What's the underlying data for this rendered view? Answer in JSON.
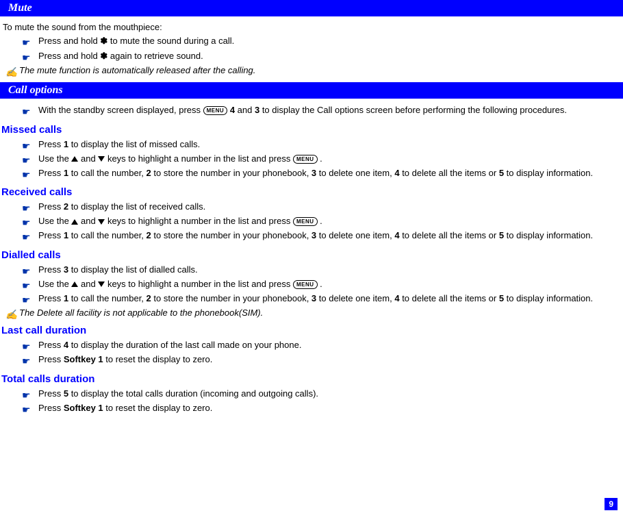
{
  "sections": {
    "mute": {
      "title": "Mute",
      "intro": "To mute the sound from the mouthpiece:",
      "bullets": [
        {
          "prefix": "Press and hold ",
          "icon": "asterisk",
          "suffix": " to mute the sound during a call."
        },
        {
          "prefix": "Press and hold ",
          "icon": "asterisk",
          "suffix": " again to retrieve sound."
        }
      ],
      "note": "The mute function is automatically released after the calling."
    },
    "callOptions": {
      "title": "Call options",
      "bullets": [
        {
          "prefix": "With the standby screen displayed, press ",
          "menu": true,
          "mid": " ",
          "b1": "4",
          "mid2": " and ",
          "b2": "3",
          "suffix": " to display the Call options screen before performing the following procedures."
        }
      ]
    },
    "missedCalls": {
      "title": "Missed calls",
      "bullets": [
        {
          "prefix": "Press ",
          "b1": "1",
          "suffix": " to display the list of missed calls."
        },
        {
          "prefix": "Use the ",
          "updown": true,
          "mid": " keys to highlight a number in the list and press ",
          "menu": true,
          "suffix": " ."
        },
        {
          "prefix": "Press ",
          "b1": "1",
          "mid": " to call the number, ",
          "b2": "2",
          "mid2": " to store the number in your phonebook, ",
          "b3": "3",
          "mid3": " to delete one item, ",
          "b4": "4",
          "mid4": " to delete all the items or ",
          "b5": "5",
          "suffix": " to display information."
        }
      ]
    },
    "receivedCalls": {
      "title": "Received calls",
      "bullets": [
        {
          "prefix": "Press ",
          "b1": "2",
          "suffix": " to display the list of received calls."
        },
        {
          "prefix": "Use the ",
          "updown": true,
          "mid": " keys to highlight a number in the list and press ",
          "menu": true,
          "suffix": " ."
        },
        {
          "prefix": "Press ",
          "b1": "1",
          "mid": " to call the number, ",
          "b2": "2",
          "mid2": " to store the number in your phonebook, ",
          "b3": "3",
          "mid3": " to delete one item, ",
          "b4": "4",
          "mid4": " to delete all the items or ",
          "b5": "5",
          "suffix": " to display information."
        }
      ]
    },
    "dialledCalls": {
      "title": "Dialled calls",
      "bullets": [
        {
          "prefix": "Press ",
          "b1": "3",
          "suffix": " to display the list of dialled calls."
        },
        {
          "prefix": "Use the ",
          "updown": true,
          "mid": " keys to highlight a number in the list and press ",
          "menu": true,
          "suffix": " ."
        },
        {
          "prefix": "Press ",
          "b1": "1",
          "mid": " to call the number, ",
          "b2": "2",
          "mid2": " to store the number in your phonebook, ",
          "b3": "3",
          "mid3": " to delete one item, ",
          "b4": "4",
          "mid4": " to delete all the items or ",
          "b5": "5",
          "suffix": " to display information."
        }
      ],
      "note": "The Delete all facility is not applicable to the phonebook(SIM)."
    },
    "lastCallDuration": {
      "title": "Last call duration",
      "bullets": [
        {
          "prefix": "Press ",
          "b1": "4",
          "suffix": " to display the duration of the last call made on your phone."
        },
        {
          "prefix": "Press ",
          "b1": "Softkey 1",
          "suffix": " to reset the display to zero."
        }
      ]
    },
    "totalCallsDuration": {
      "title": "Total calls duration",
      "bullets": [
        {
          "prefix": "Press ",
          "b1": "5",
          "suffix": " to display the total calls duration (incoming and outgoing calls)."
        },
        {
          "prefix": "Press ",
          "b1": "Softkey 1",
          "suffix": " to reset the display to zero."
        }
      ]
    }
  },
  "menuLabel": "MENU",
  "asteriskSymbol": "✽",
  "pointerSymbol": "☛",
  "handSymbol": "✍",
  "pageNumber": "9"
}
